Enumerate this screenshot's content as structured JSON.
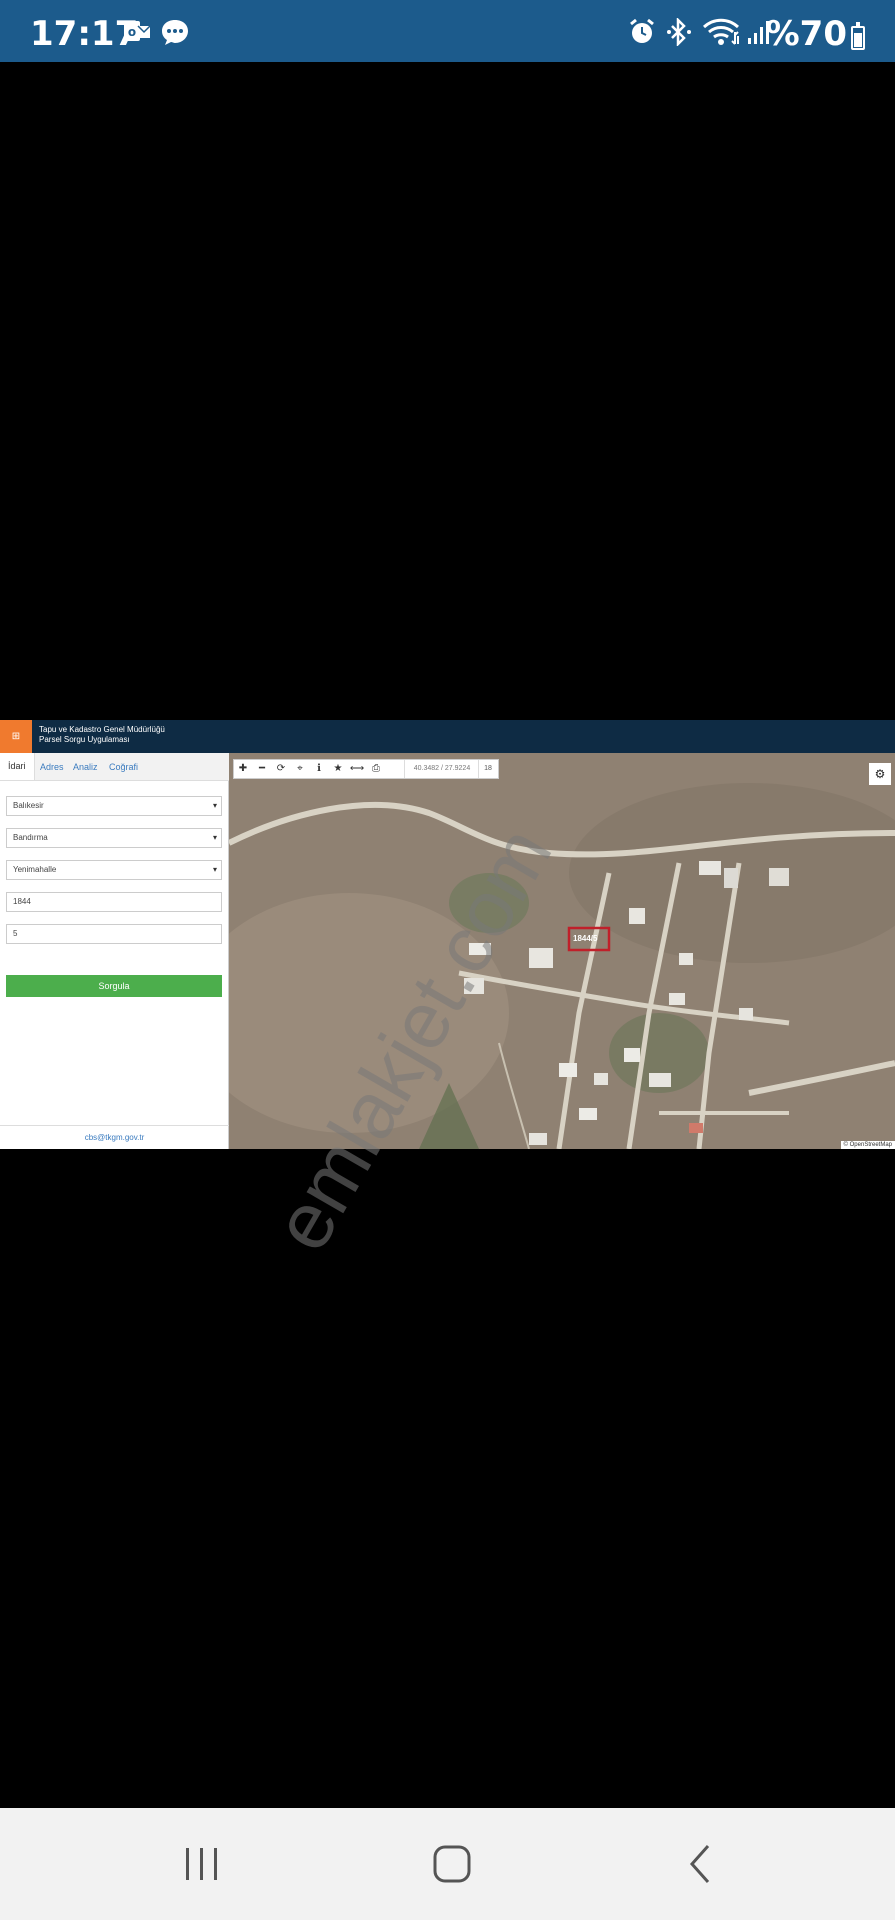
{
  "status_bar": {
    "time": "17:17",
    "battery_text": "%70",
    "battery_level": 0.7,
    "icons": [
      "outlook-mail-icon",
      "chat-bubble-icon",
      "alarm-icon",
      "bluetooth-icon",
      "wifi-icon",
      "cellular-signal-icon",
      "battery-icon"
    ]
  },
  "embedded_app": {
    "org_line1": "Tapu ve Kadastro Genel Müdürlüğü",
    "org_line2": "Parsel Sorgu Uygulaması",
    "tabs": [
      "İdari",
      "Adres",
      "Analiz",
      "Coğrafi"
    ],
    "active_tab": "İdari",
    "fields": {
      "province": "Balıkesir",
      "district": "Bandırma",
      "neighborhood": "Yenimahalle",
      "block": "1844",
      "parcel": "5"
    },
    "query_button": "Sorgula",
    "footer_email": "cbs@tkgm.gov.tr",
    "map": {
      "coordinates": "40.3482 / 27.9224",
      "zoom": "18",
      "parcel_label": "1844/5",
      "attribution": "© OpenStreetMap"
    }
  },
  "watermark": "emlakjet.com",
  "colors": {
    "status_bar": "#1c5b8c",
    "app_header": "#0e2b44",
    "logo": "#f07a2e",
    "query_button": "#4cae4c",
    "parcel_outline": "#c0202a"
  }
}
